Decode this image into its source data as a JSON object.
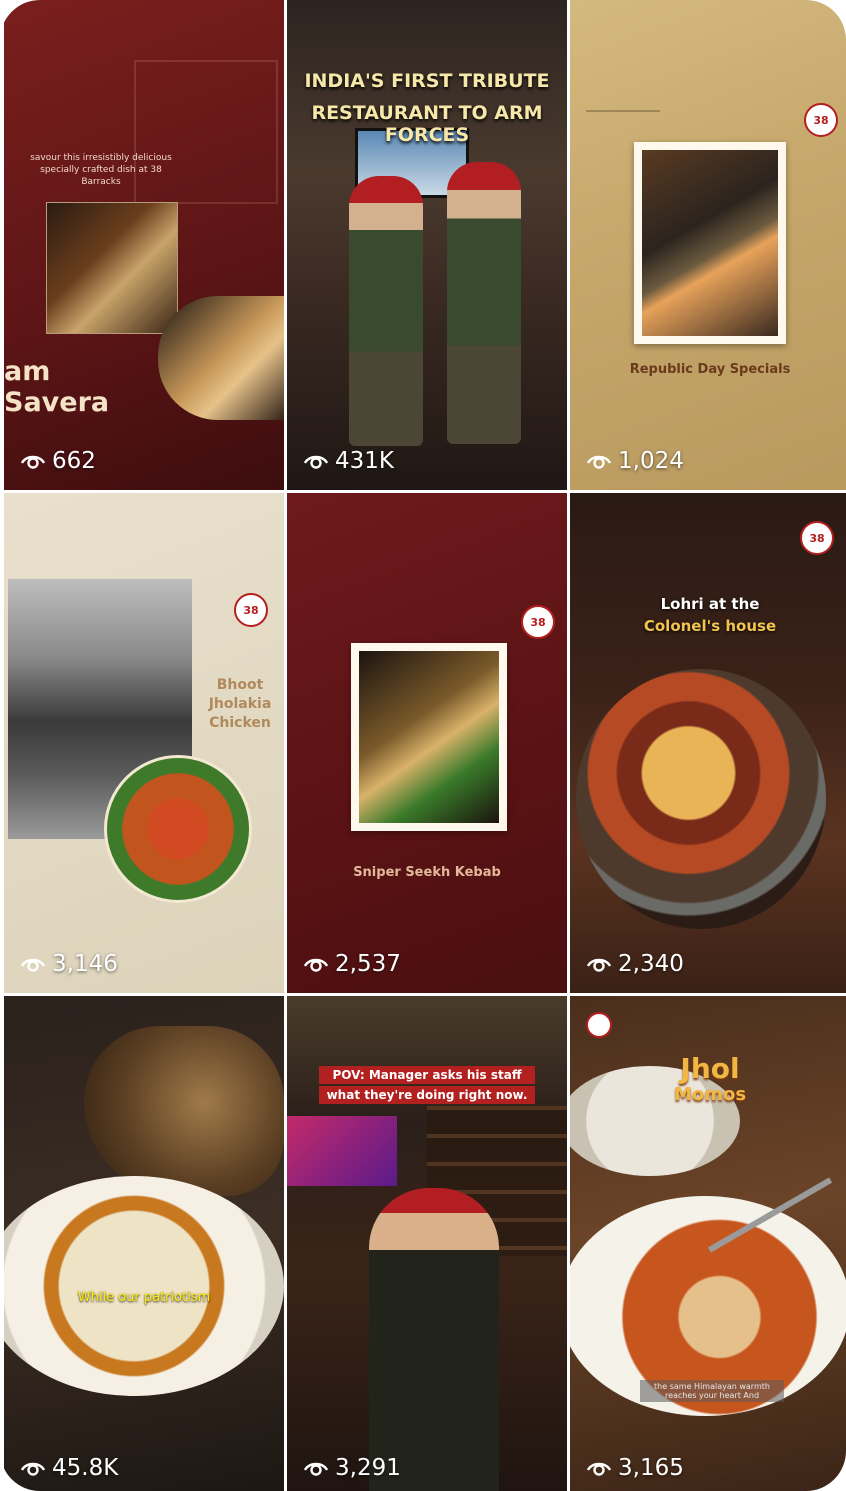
{
  "tiles": [
    {
      "views": "662",
      "caption_small": "savour this irresistibly delicious specially crafted dish at 38 Barracks",
      "caption_big": "am Savera"
    },
    {
      "views": "431K",
      "headline_line1": "INDIA'S FIRST TRIBUTE",
      "headline_line2": "RESTAURANT TO ARM FORCES"
    },
    {
      "views": "1,024",
      "caption": "Republic Day Specials",
      "logo": "38"
    },
    {
      "views": "3,146",
      "title_line1": "Bhoot",
      "title_line2": "Jholakia",
      "title_line3": "Chicken",
      "logo": "38"
    },
    {
      "views": "2,537",
      "caption": "Sniper Seekh Kebab",
      "logo": "38"
    },
    {
      "views": "2,340",
      "title_line1": "Lohri at the",
      "title_line2": "Colonel's house",
      "logo": "38"
    },
    {
      "views": "45.8K",
      "subtitle": "While our patriotism"
    },
    {
      "views": "3,291",
      "caption_line1": "POV: Manager asks his staff",
      "caption_line2": "what they're doing right now."
    },
    {
      "views": "3,165",
      "title_line1": "Jhol",
      "title_line2": "Momos",
      "subtitle": "the same Himalayan warmth reaches your heart And"
    }
  ],
  "icons": {
    "views": "eye-icon"
  },
  "colors": {
    "maroon": "#6e1a1c",
    "beige": "#c9ad72",
    "cream": "#e6ddc9",
    "badge_red": "#b41e1e",
    "gold": "#f2b642"
  }
}
